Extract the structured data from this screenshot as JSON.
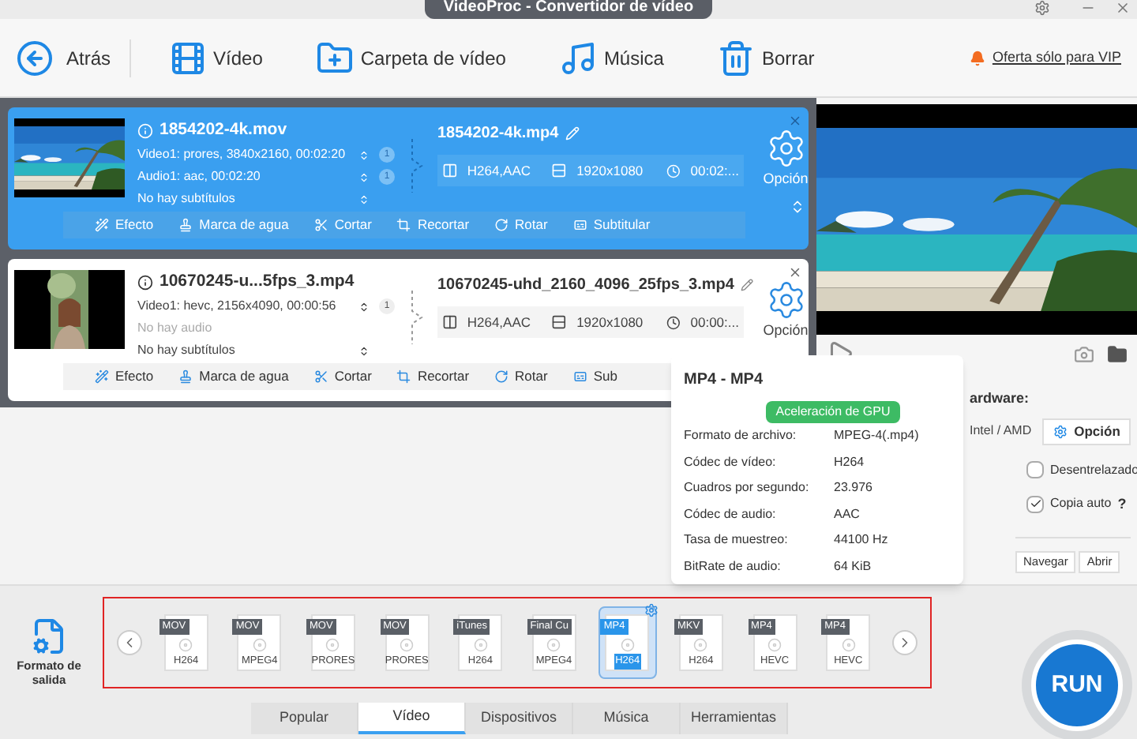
{
  "window": {
    "title": "VideoProc - Convertidor de vídeo"
  },
  "toolbar": {
    "back": "Atrás",
    "buttons": [
      {
        "label": "Vídeo",
        "kind": "video"
      },
      {
        "label": "Carpeta de vídeo",
        "kind": "folder"
      },
      {
        "label": "Música",
        "kind": "music"
      },
      {
        "label": "Borrar",
        "kind": "delete"
      }
    ],
    "vip_offer": "Oferta sólo para VIP"
  },
  "files": [
    {
      "selected": true,
      "source_name": "1854202-4k.mov",
      "streams": [
        {
          "text": "Video1: prores, 3840x2160, 00:02:20",
          "count": "1",
          "disabled": false
        },
        {
          "text": "Audio1: aac, 00:02:20",
          "count": "1",
          "disabled": false
        },
        {
          "text": "No hay subtítulos",
          "disabled": false
        }
      ],
      "output_name": "1854202-4k.mp4",
      "codec": "H264,AAC",
      "resolution": "1920x1080",
      "duration": "00:02:...",
      "option": "Opción",
      "tools": [
        {
          "label": "Efecto",
          "kind": "effect"
        },
        {
          "label": "Marca de agua",
          "kind": "watermark"
        },
        {
          "label": "Cortar",
          "kind": "cut"
        },
        {
          "label": "Recortar",
          "kind": "crop"
        },
        {
          "label": "Rotar",
          "kind": "rotate"
        },
        {
          "label": "Subtitular",
          "kind": "subtitle"
        }
      ]
    },
    {
      "selected": false,
      "source_name": "10670245-u...5fps_3.mp4",
      "streams": [
        {
          "text": "Video1: hevc, 2156x4090, 00:00:56",
          "count": "1",
          "disabled": false
        },
        {
          "text": "No hay audio",
          "disabled": true
        },
        {
          "text": "No hay subtítulos",
          "disabled": false
        }
      ],
      "output_name": "10670245-uhd_2160_4096_25fps_3.mp4",
      "codec": "H264,AAC",
      "resolution": "1920x1080",
      "duration": "00:00:...",
      "option": "Opción",
      "tools": [
        {
          "label": "Efecto",
          "kind": "effect"
        },
        {
          "label": "Marca de agua",
          "kind": "watermark"
        },
        {
          "label": "Cortar",
          "kind": "cut"
        },
        {
          "label": "Recortar",
          "kind": "crop"
        },
        {
          "label": "Rotar",
          "kind": "rotate"
        },
        {
          "label": "Sub",
          "kind": "subtitle"
        }
      ]
    }
  ],
  "settings": {
    "hardware_label": "ardware:",
    "hardware_value": "Intel / AMD",
    "option_button": "Opción",
    "deinterlace": {
      "label": "Desentrelazado",
      "checked": false
    },
    "auto_copy": {
      "label": "Copia auto",
      "checked": true,
      "help": "?"
    },
    "buttons": [
      "Navegar",
      "Abrir"
    ]
  },
  "format_popup": {
    "title": "MP4 - MP4",
    "badge": "Aceleración de GPU",
    "rows": [
      {
        "label": "Formato de archivo:",
        "value": "MPEG-4(.mp4)"
      },
      {
        "label": "Códec de vídeo:",
        "value": "H264"
      },
      {
        "label": "Cuadros por segundo:",
        "value": "23.976"
      },
      {
        "label": "Códec de audio:",
        "value": "AAC"
      },
      {
        "label": "Tasa de muestreo:",
        "value": "44100 Hz"
      },
      {
        "label": "BitRate de audio:",
        "value": "64 KiB"
      }
    ]
  },
  "output_format": {
    "label": "Formato de salida",
    "formats": [
      {
        "top": "MOV",
        "bottom": "H264",
        "selected": false
      },
      {
        "top": "MOV",
        "bottom": "MPEG4",
        "selected": false
      },
      {
        "top": "MOV",
        "bottom": "PRORES",
        "selected": false
      },
      {
        "top": "MOV",
        "bottom": "PRORES",
        "selected": false
      },
      {
        "top": "iTunes",
        "bottom": "H264",
        "selected": false
      },
      {
        "top": "Final Cu",
        "bottom": "MPEG4",
        "selected": false
      },
      {
        "top": "MP4",
        "bottom": "H264",
        "selected": true
      },
      {
        "top": "MKV",
        "bottom": "H264",
        "selected": false
      },
      {
        "top": "MP4",
        "bottom": "HEVC",
        "selected": false
      },
      {
        "top": "MP4",
        "bottom": "HEVC",
        "selected": false
      }
    ]
  },
  "run_button": "RUN",
  "category_tabs": [
    {
      "label": "Popular",
      "selected": false
    },
    {
      "label": "Vídeo",
      "selected": true
    },
    {
      "label": "Dispositivos",
      "selected": false
    },
    {
      "label": "Música",
      "selected": false
    },
    {
      "label": "Herramientas",
      "selected": false
    }
  ]
}
